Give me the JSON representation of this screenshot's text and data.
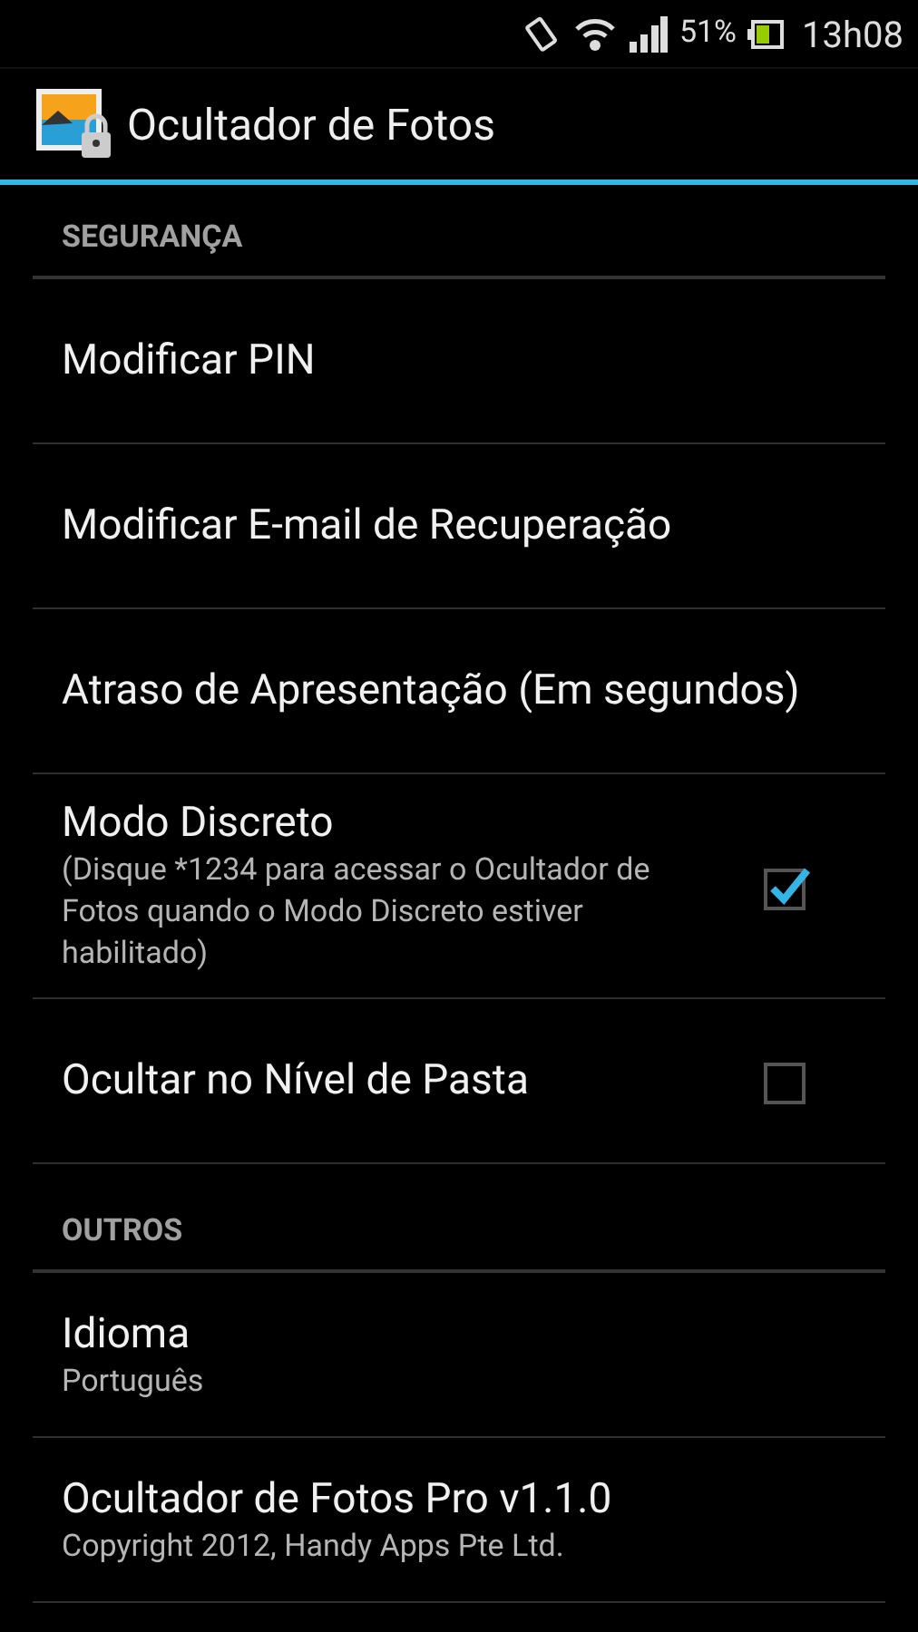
{
  "status_bar": {
    "battery": "51%",
    "time": "13h08"
  },
  "action_bar": {
    "title": "Ocultador de Fotos"
  },
  "sections": [
    {
      "header": "SEGURANÇA",
      "items": [
        {
          "kind": "plain",
          "title": "Modificar PIN"
        },
        {
          "kind": "plain",
          "title": "Modificar E-mail de Recuperação"
        },
        {
          "kind": "plain",
          "title": "Atraso de Apresentação (Em segundos)"
        },
        {
          "kind": "checkbox",
          "title": "Modo Discreto",
          "summary": "(Disque *1234 para acessar o Ocultador de Fotos quando o Modo Discreto estiver habilitado)",
          "checked": true
        },
        {
          "kind": "checkbox",
          "title": "Ocultar no Nível de Pasta",
          "checked": false
        }
      ]
    },
    {
      "header": "OUTROS",
      "items": [
        {
          "kind": "plain",
          "title": "Idioma",
          "summary": "Português"
        },
        {
          "kind": "plain",
          "title": "Ocultador de Fotos Pro v1.1.0",
          "summary": "Copyright 2012, Handy Apps Pte Ltd."
        }
      ]
    }
  ]
}
